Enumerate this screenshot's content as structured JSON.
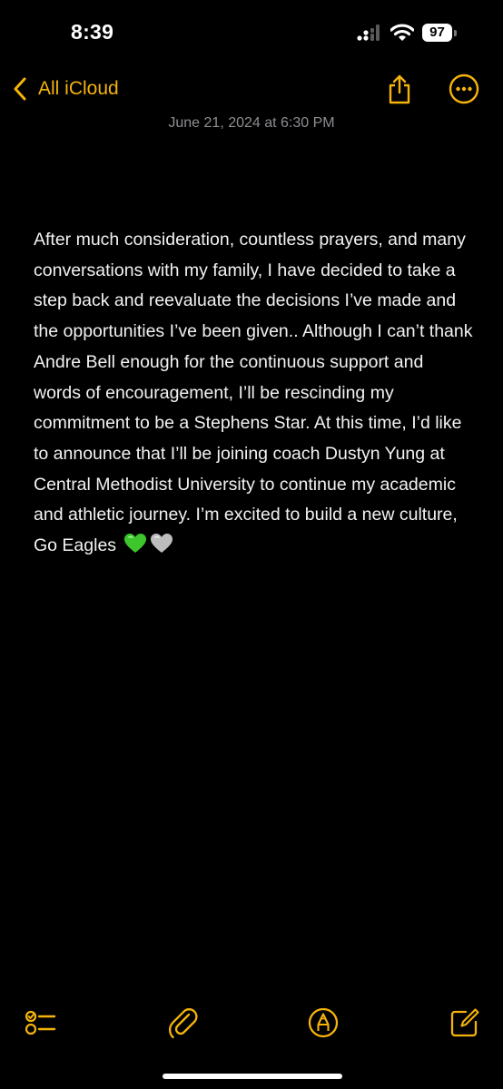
{
  "status_bar": {
    "time": "8:39",
    "battery_level": "97"
  },
  "nav": {
    "back_label": "All iCloud"
  },
  "note": {
    "date": "June 21, 2024 at 6:30 PM",
    "body": "After much consideration, countless prayers, and many conversations with my family, I have decided to take a step back and reevaluate the decisions I’ve made and the opportunities I’ve been given.. Although I can’t thank Andre Bell enough for the continuous support and words of encouragement, I’ll be rescinding my commitment to be a Stephens Star. At this time, I’d like to announce that I’ll be joining coach Dustyn Yung at Central Methodist University to continue my academic and athletic journey. I’m excited to build a new culture, Go Eagles",
    "trailing_emoji": [
      "green-heart",
      "grey-heart"
    ]
  },
  "toolbar": {
    "icons": [
      "checklist-icon",
      "paperclip-icon",
      "markup-pen-icon",
      "compose-icon"
    ]
  },
  "colors": {
    "accent": "#f5b40a",
    "background": "#000000",
    "text": "#f2f2f2",
    "secondary_text": "#8e8e93",
    "green_heart": "#3cc62c",
    "grey_heart": "#bdbdbd"
  }
}
